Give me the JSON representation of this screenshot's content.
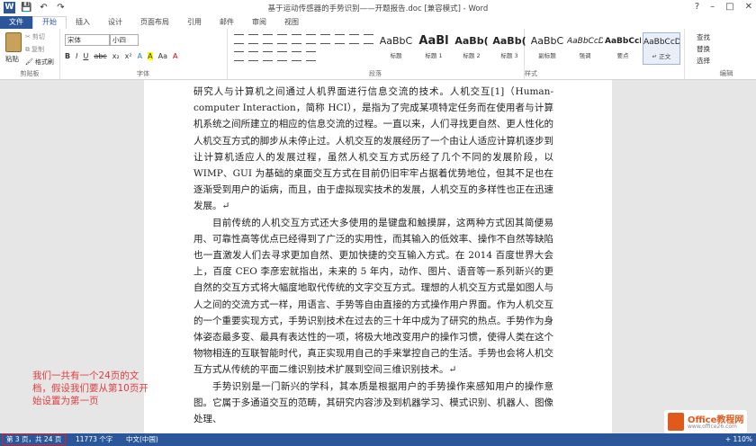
{
  "window": {
    "title": "基于运动传感器的手势识别——开题报告.doc [兼容模式] - Word",
    "app_icon": "W"
  },
  "tabs": [
    {
      "label": "文件"
    },
    {
      "label": "开始"
    },
    {
      "label": "插入"
    },
    {
      "label": "设计"
    },
    {
      "label": "页面布局"
    },
    {
      "label": "引用"
    },
    {
      "label": "邮件"
    },
    {
      "label": "审阅"
    },
    {
      "label": "视图"
    }
  ],
  "ribbon": {
    "clipboard": {
      "paste": "粘贴",
      "cut": "剪切",
      "copy": "复制",
      "format_painter": "格式刷",
      "label": "剪贴板"
    },
    "font": {
      "name": "宋体",
      "size": "小四",
      "label": "字体",
      "buttons": [
        "B",
        "I",
        "U",
        "abc",
        "x₂",
        "x²",
        "A",
        "A",
        "Aa",
        "A"
      ]
    },
    "paragraph": {
      "label": "段落"
    },
    "styles": {
      "label": "样式",
      "items": [
        {
          "sample": "AaBbC",
          "name": "标题"
        },
        {
          "sample": "AaBl",
          "name": "标题 1"
        },
        {
          "sample": "AaBb(",
          "name": "标题 2"
        },
        {
          "sample": "AaBb(",
          "name": "标题 3"
        },
        {
          "sample": "AaBbC",
          "name": "副标题"
        },
        {
          "sample": "AaBbCcD",
          "name": "强调"
        },
        {
          "sample": "AaBbCcD",
          "name": "要点"
        },
        {
          "sample": "AaBbCcDc",
          "name": "↵ 正文"
        }
      ]
    },
    "editing": {
      "find": "查找",
      "replace": "替换",
      "select": "选择",
      "label": "编辑"
    }
  },
  "document": {
    "paragraphs": [
      {
        "text": "研究人与计算机之间通过人机界面进行信息交流的技术。人机交互[1]（Human-computer Interaction，简称 HCI），是指为了完成某项特定任务而在使用者与计算机系统之间所建立的相应的信息交流的过程。一直以来，人们寻找更自然、更人性化的人机交互方式的脚步从未停止过。人机交互的发展经历了一个由让人适应计算机逐步到让计算机适应人的发展过程，虽然人机交互方式历经了几个不同的发展阶段，以 WIMP、GUI 为基础的桌面交互方式在目前仍旧牢牢占据着优势地位，但其不足也在逐渐受到用户的诟病，而且，由于虚拟现实技术的发展，人机交互的多样性也正在迅速发展。↵",
        "indent": false
      },
      {
        "text": "目前传统的人机交互方式还大多使用的是键盘和触摸屏，这两种方式因其简便易用、可靠性高等优点已经得到了广泛的实用性，而其输入的低效率、操作不自然等缺陷也一直激发人们去寻求更加自然、更加快捷的交互输入方式。在 2014 百度世界大会上，百度 CEO 李彦宏就指出，未来的 5 年内，动作、图片、语音等一系列新兴的更自然的交互方式将大幅度地取代传统的文字交互方式。理想的人机交互方式是如图人与人之间的交流方式一样，用语言、手势等自由直接的方式操作用户界面。作为人机交互的一个重要实现方式，手势识别技术在过去的三十年中成为了研究的热点。手势作为身体姿态最多变、最具有表达性的一项，将极大地改变用户的操作习惯，使得人类在这个物物相连的互联智能时代，真正实现用自己的手来掌控自己的生活。手势也会将人机交互方式从传统的平面二维识别技术扩展到空间三维识别技术。↵",
        "indent": true
      },
      {
        "text": "手势识别是一门新兴的学科，其本质是根据用户的手势操作来感知用户的操作意图。它属于多通道交互的范畴，其研究内容涉及到机器学习、模式识别、机器人、图像处理、",
        "indent": true
      }
    ]
  },
  "annotation": {
    "text": "我们一共有一个24页的文档，假设我们要从第10页开始设置为第一页"
  },
  "status": {
    "page": "第 3 页，共 24 页",
    "words": "11773 个字",
    "lang": "中文(中国)",
    "zoom": "+ 110%"
  },
  "watermark": {
    "title": "Office教程网",
    "url": "www.office26.com"
  }
}
